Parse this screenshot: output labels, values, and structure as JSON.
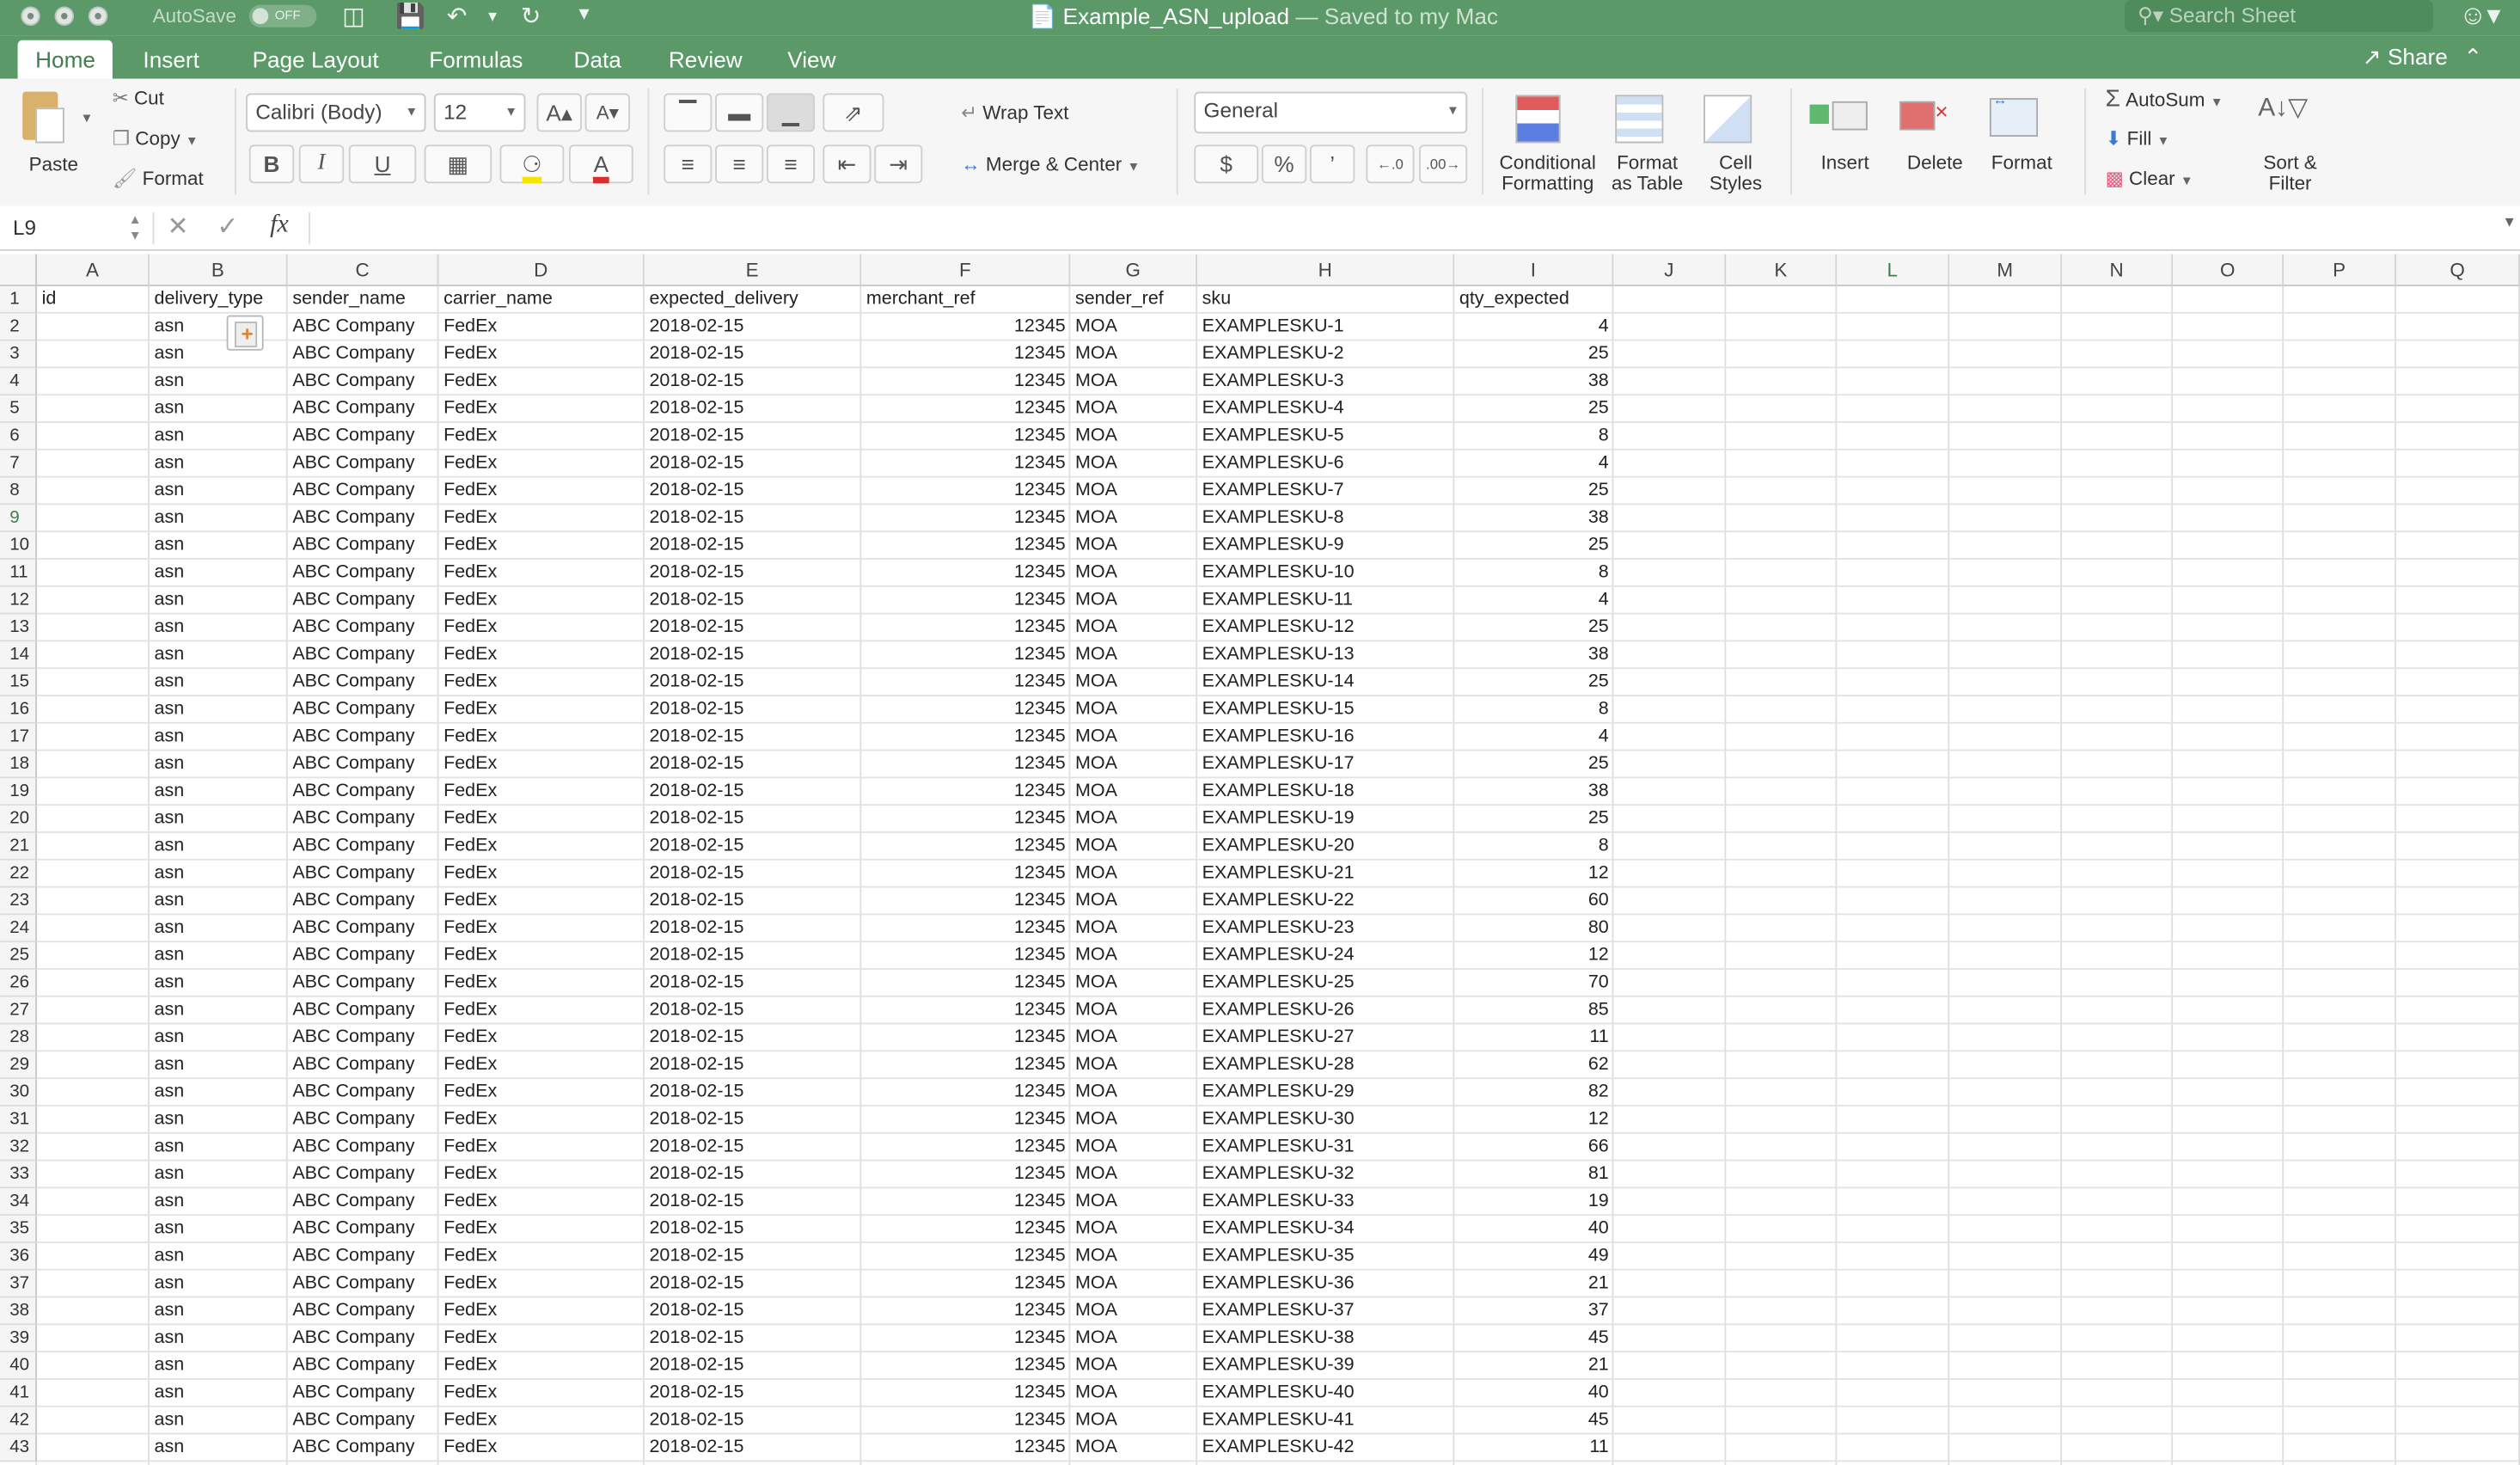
{
  "window": {
    "autosave_label": "AutoSave",
    "autosave_state": "OFF",
    "title": "Example_ASN_upload",
    "saved_status": "— Saved to my Mac",
    "search_placeholder": "Search Sheet"
  },
  "tabs": [
    "Home",
    "Insert",
    "Page Layout",
    "Formulas",
    "Data",
    "Review",
    "View"
  ],
  "share_label": "Share",
  "ribbon": {
    "paste": "Paste",
    "cut": "Cut",
    "copy": "Copy",
    "format_painter": "Format",
    "font_name": "Calibri (Body)",
    "font_size": "12",
    "bold": "B",
    "italic": "I",
    "underline": "U",
    "wrap_text": "Wrap Text",
    "merge_center": "Merge & Center",
    "number_format": "General",
    "currency": "$",
    "percent": "%",
    "comma": "’",
    "cond_format": [
      "Conditional",
      "Formatting"
    ],
    "format_table": [
      "Format",
      "as Table"
    ],
    "cell_styles": [
      "Cell",
      "Styles"
    ],
    "insert": "Insert",
    "delete": "Delete",
    "format": "Format",
    "autosum": "AutoSum",
    "fill": "Fill",
    "clear": "Clear",
    "sort_filter": [
      "Sort &",
      "Filter"
    ]
  },
  "formula_bar": {
    "name_box": "L9",
    "fx": "fx",
    "formula": ""
  },
  "columns": [
    "A",
    "B",
    "C",
    "D",
    "E",
    "F",
    "G",
    "H",
    "I",
    "J",
    "K",
    "L",
    "M",
    "N",
    "O",
    "P",
    "Q"
  ],
  "selected_column": "L",
  "selected_row": "9",
  "header_row": [
    "id",
    "delivery_type",
    "sender_name",
    "carrier_name",
    "expected_delivery",
    "merchant_ref",
    "sender_ref",
    "sku",
    "qty_expected"
  ],
  "data_defaults": {
    "id": "",
    "delivery_type": "asn",
    "sender_name": "ABC Company",
    "carrier_name": "FedEx",
    "expected_delivery": "2018-02-15",
    "merchant_ref": "12345",
    "sender_ref": "MOA",
    "sku_prefix": "EXAMPLESKU-"
  },
  "rows": [
    {
      "row": "2",
      "sku": "EXAMPLESKU-1",
      "qty": "4"
    },
    {
      "row": "3",
      "sku": "EXAMPLESKU-2",
      "qty": "25"
    },
    {
      "row": "4",
      "sku": "EXAMPLESKU-3",
      "qty": "38"
    },
    {
      "row": "5",
      "sku": "EXAMPLESKU-4",
      "qty": "25"
    },
    {
      "row": "6",
      "sku": "EXAMPLESKU-5",
      "qty": "8"
    },
    {
      "row": "7",
      "sku": "EXAMPLESKU-6",
      "qty": "4"
    },
    {
      "row": "8",
      "sku": "EXAMPLESKU-7",
      "qty": "25"
    },
    {
      "row": "9",
      "sku": "EXAMPLESKU-8",
      "qty": "38"
    },
    {
      "row": "10",
      "sku": "EXAMPLESKU-9",
      "qty": "25"
    },
    {
      "row": "11",
      "sku": "EXAMPLESKU-10",
      "qty": "8"
    },
    {
      "row": "12",
      "sku": "EXAMPLESKU-11",
      "qty": "4"
    },
    {
      "row": "13",
      "sku": "EXAMPLESKU-12",
      "qty": "25"
    },
    {
      "row": "14",
      "sku": "EXAMPLESKU-13",
      "qty": "38"
    },
    {
      "row": "15",
      "sku": "EXAMPLESKU-14",
      "qty": "25"
    },
    {
      "row": "16",
      "sku": "EXAMPLESKU-15",
      "qty": "8"
    },
    {
      "row": "17",
      "sku": "EXAMPLESKU-16",
      "qty": "4"
    },
    {
      "row": "18",
      "sku": "EXAMPLESKU-17",
      "qty": "25"
    },
    {
      "row": "19",
      "sku": "EXAMPLESKU-18",
      "qty": "38"
    },
    {
      "row": "20",
      "sku": "EXAMPLESKU-19",
      "qty": "25"
    },
    {
      "row": "21",
      "sku": "EXAMPLESKU-20",
      "qty": "8"
    },
    {
      "row": "22",
      "sku": "EXAMPLESKU-21",
      "qty": "12"
    },
    {
      "row": "23",
      "sku": "EXAMPLESKU-22",
      "qty": "60"
    },
    {
      "row": "24",
      "sku": "EXAMPLESKU-23",
      "qty": "80"
    },
    {
      "row": "25",
      "sku": "EXAMPLESKU-24",
      "qty": "12"
    },
    {
      "row": "26",
      "sku": "EXAMPLESKU-25",
      "qty": "70"
    },
    {
      "row": "27",
      "sku": "EXAMPLESKU-26",
      "qty": "85"
    },
    {
      "row": "28",
      "sku": "EXAMPLESKU-27",
      "qty": "11"
    },
    {
      "row": "29",
      "sku": "EXAMPLESKU-28",
      "qty": "62"
    },
    {
      "row": "30",
      "sku": "EXAMPLESKU-29",
      "qty": "82"
    },
    {
      "row": "31",
      "sku": "EXAMPLESKU-30",
      "qty": "12"
    },
    {
      "row": "32",
      "sku": "EXAMPLESKU-31",
      "qty": "66"
    },
    {
      "row": "33",
      "sku": "EXAMPLESKU-32",
      "qty": "81"
    },
    {
      "row": "34",
      "sku": "EXAMPLESKU-33",
      "qty": "19"
    },
    {
      "row": "35",
      "sku": "EXAMPLESKU-34",
      "qty": "40"
    },
    {
      "row": "36",
      "sku": "EXAMPLESKU-35",
      "qty": "49"
    },
    {
      "row": "37",
      "sku": "EXAMPLESKU-36",
      "qty": "21"
    },
    {
      "row": "38",
      "sku": "EXAMPLESKU-37",
      "qty": "37"
    },
    {
      "row": "39",
      "sku": "EXAMPLESKU-38",
      "qty": "45"
    },
    {
      "row": "40",
      "sku": "EXAMPLESKU-39",
      "qty": "21"
    },
    {
      "row": "41",
      "sku": "EXAMPLESKU-40",
      "qty": "40"
    },
    {
      "row": "42",
      "sku": "EXAMPLESKU-41",
      "qty": "45"
    },
    {
      "row": "43",
      "sku": "EXAMPLESKU-42",
      "qty": "11"
    }
  ],
  "colors": {
    "accent": "#5b9a68",
    "ribbon_bg": "#f6f6f6",
    "selected_header": "#3f7f4e"
  }
}
